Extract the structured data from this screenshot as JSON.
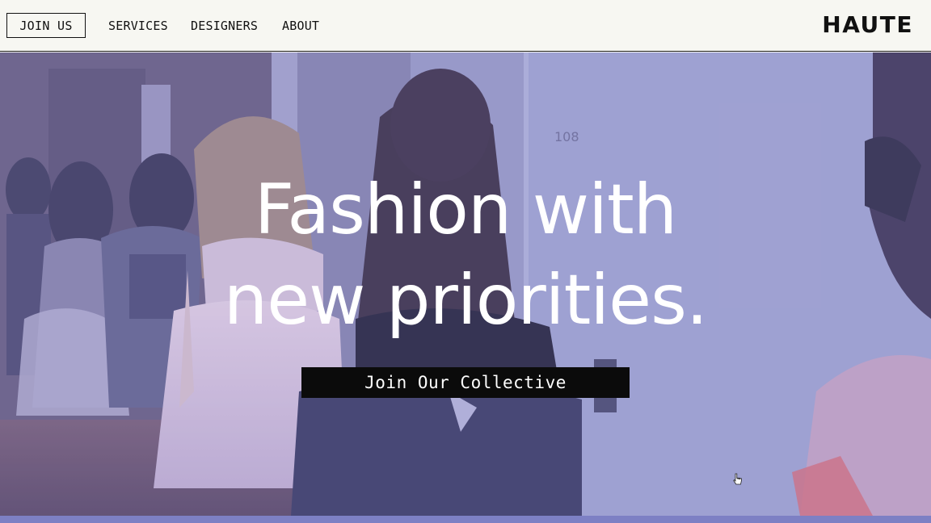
{
  "header": {
    "join_button": "JOIN US",
    "nav": [
      "SERVICES",
      "DESIGNERS",
      "ABOUT"
    ],
    "brand": "HAUTE"
  },
  "hero": {
    "headline_line1": "Fashion with",
    "headline_line2": "new priorities.",
    "cta_label": "Join Our Collective",
    "door_number": "108"
  },
  "colors": {
    "header_bg": "#f7f7f2",
    "hero_overlay": "#8c8ccd",
    "cta_bg": "#0b0b0b",
    "text_light": "#ffffff"
  },
  "icons": [
    "pointer-cursor-icon"
  ]
}
